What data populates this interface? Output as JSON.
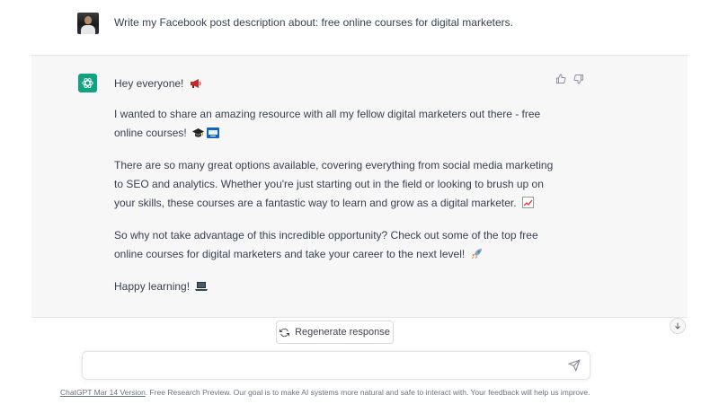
{
  "conversation": {
    "user_message": "Write my Facebook post description about: free online courses for digital marketers.",
    "assistant": {
      "greeting": "Hey everyone! ",
      "para1": "I wanted to share an amazing resource with all my fellow digital marketers out there - free online courses! ",
      "para2": "There are so many great options available, covering everything from social media marketing to SEO and analytics. Whether you're just starting out in the field or looking to brush up on your skills, these courses are a fantastic way to learn and grow as a digital marketer. ",
      "para3": "So why not take advantage of this incredible opportunity? Check out some of the top free online courses for digital marketers and take your career to the next level! ",
      "para4": "Happy learning! "
    }
  },
  "controls": {
    "regenerate_label": "Regenerate response",
    "input_placeholder": ""
  },
  "footer": {
    "link_text": "ChatGPT Mar 14 Version",
    "text": ". Free Research Preview. Our goal is to make AI systems more natural and safe to interact with. Your feedback will help us improve."
  },
  "icons": {
    "gpt_logo": "openai-logo-icon",
    "thumbs_up": "thumbs-up-icon",
    "thumbs_down": "thumbs-down-icon",
    "regenerate": "refresh-icon",
    "send": "send-icon",
    "scroll_down": "arrow-down-icon",
    "megaphone": "megaphone-emoji",
    "grad_cap": "graduation-cap-emoji",
    "computer": "computer-emoji",
    "chart": "chart-increasing-emoji",
    "rocket": "rocket-emoji",
    "laptop": "laptop-emoji"
  },
  "colors": {
    "accent": "#10a37f",
    "assistant_bg": "#f7f7f8",
    "text": "#374151"
  }
}
